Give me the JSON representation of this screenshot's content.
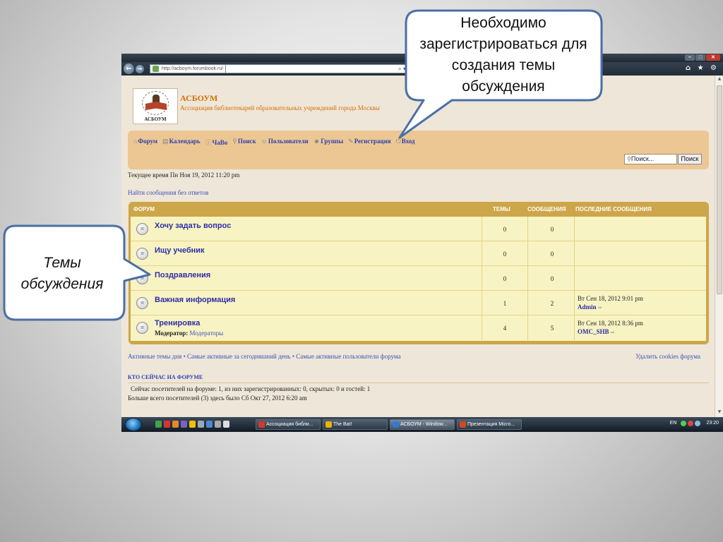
{
  "browser": {
    "url": "http://acboym.forumbook.ru/",
    "search_icon_text": "⌕ ▾",
    "nav_icons": "⌂ ★ ⚙"
  },
  "site": {
    "logo_text": "АСБОУМ",
    "title": "АСБОУМ",
    "description": "Ассоциация библиотекарей образовательных учреждений города Москвы"
  },
  "menu": {
    "items": [
      {
        "label": "Форум",
        "icon": "home-icon"
      },
      {
        "label": "Календарь",
        "icon": "calendar-icon"
      },
      {
        "label": "ЧаВо",
        "icon": "help-icon"
      },
      {
        "label": "Поиск",
        "icon": "search-icon"
      },
      {
        "label": "Пользователи",
        "icon": "user-icon"
      },
      {
        "label": "Группы",
        "icon": "group-icon"
      },
      {
        "label": "Регистрация",
        "icon": "pencil-icon"
      },
      {
        "label": "Вход",
        "icon": "login-icon"
      }
    ],
    "search_placeholder": "Поиск...",
    "search_button": "Поиск"
  },
  "current_time": "Текущее время Пн Ноя 19, 2012 11:20 pm",
  "unanswered_link": "Найти сообщения без ответов",
  "forum": {
    "headers": {
      "forum": "ФОРУМ",
      "topics": "ТЕМЫ",
      "posts": "СООБЩЕНИЯ",
      "last": "ПОСЛЕДНИЕ СООБЩЕНИЯ"
    },
    "rows": [
      {
        "title": "Хочу задать вопрос",
        "topics": "0",
        "posts": "0"
      },
      {
        "title": "Ищу учебник",
        "topics": "0",
        "posts": "0"
      },
      {
        "title": "Поздравления",
        "topics": "0",
        "posts": "0"
      },
      {
        "title": "Важная информация",
        "topics": "1",
        "posts": "2",
        "last_date": "Вт Сен 18, 2012 9:01 pm",
        "last_author": "Admin"
      },
      {
        "title": "Тренировка",
        "topics": "4",
        "posts": "5",
        "last_date": "Вт Сен 18, 2012 8:36 pm",
        "last_author": "OMC_SHB",
        "moderator_label": "Модератор:",
        "moderator_value": "Модераторы"
      }
    ]
  },
  "footer_links": {
    "left": "Активные темы дня • Самые активные за сегодняшний день • Самые активные пользователи форума",
    "delete_cookies": "Удалить cookies форума"
  },
  "who_online": {
    "title": "КТО СЕЙЧАС НА ФОРУМЕ",
    "visitors": "Сейчас посетителей на форуме: 1, из них зарегистрированных: 0, скрытых: 0 и гостей: 1",
    "max": "Больше всего посетителей (3) здесь было Сб Окт 27, 2012 6:20 am"
  },
  "taskbar": {
    "tasks": [
      {
        "label": "Ассоциация библи...",
        "color": "#d9342b"
      },
      {
        "label": "The Bat!",
        "color": "#e8b400"
      },
      {
        "label": "АСБОУМ - Window...",
        "color": "#2e7bd6"
      },
      {
        "label": "Презентация Micro...",
        "color": "#d24726"
      }
    ],
    "lang": "EN",
    "clock": "23:20"
  },
  "callouts": {
    "top": "Необходимо зарегистрироваться для создания темы обсуждения",
    "left": "Темы обсуждения"
  },
  "colors": {
    "accent_orange": "#d36f06",
    "menu_bg": "#ecc793",
    "forum_header": "#cda64a",
    "forum_row_bg": "#f8f3c2",
    "link_blue": "#2c2ea8",
    "callout_border": "#4a6fa5"
  }
}
